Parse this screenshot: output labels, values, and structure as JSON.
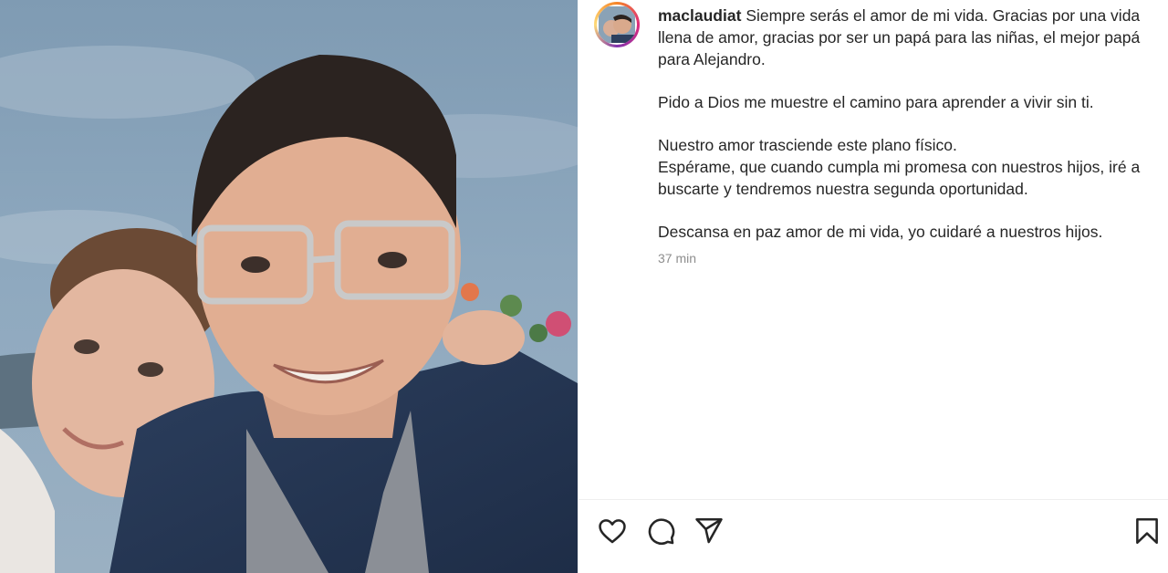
{
  "post": {
    "username": "maclaudiat",
    "caption_paragraphs": [
      "Siempre serás el amor de mi vida. Gracias por una vida llena de amor, gracias por ser un papá para las niñas, el mejor papá para Alejandro.",
      "Pido a Dios me muestre el camino para aprender a vivir sin ti.",
      "Nuestro amor trasciende este plano físico.",
      "Espérame, que cuando cumpla mi promesa con nuestros hijos, iré a buscarte y tendremos nuestra segunda oportunidad.",
      "Descansa en paz amor de mi vida, yo cuidaré a nuestros hijos."
    ],
    "timestamp": "37 min"
  },
  "actions": {
    "like_icon": "heart-icon",
    "comment_icon": "comment-icon",
    "share_icon": "send-icon",
    "save_icon": "bookmark-icon"
  },
  "colors": {
    "avatar_ring": [
      "#f58529",
      "#dd2a7b",
      "#8134af",
      "#feda77"
    ],
    "text": "#262626",
    "muted": "#8e8e8e"
  }
}
